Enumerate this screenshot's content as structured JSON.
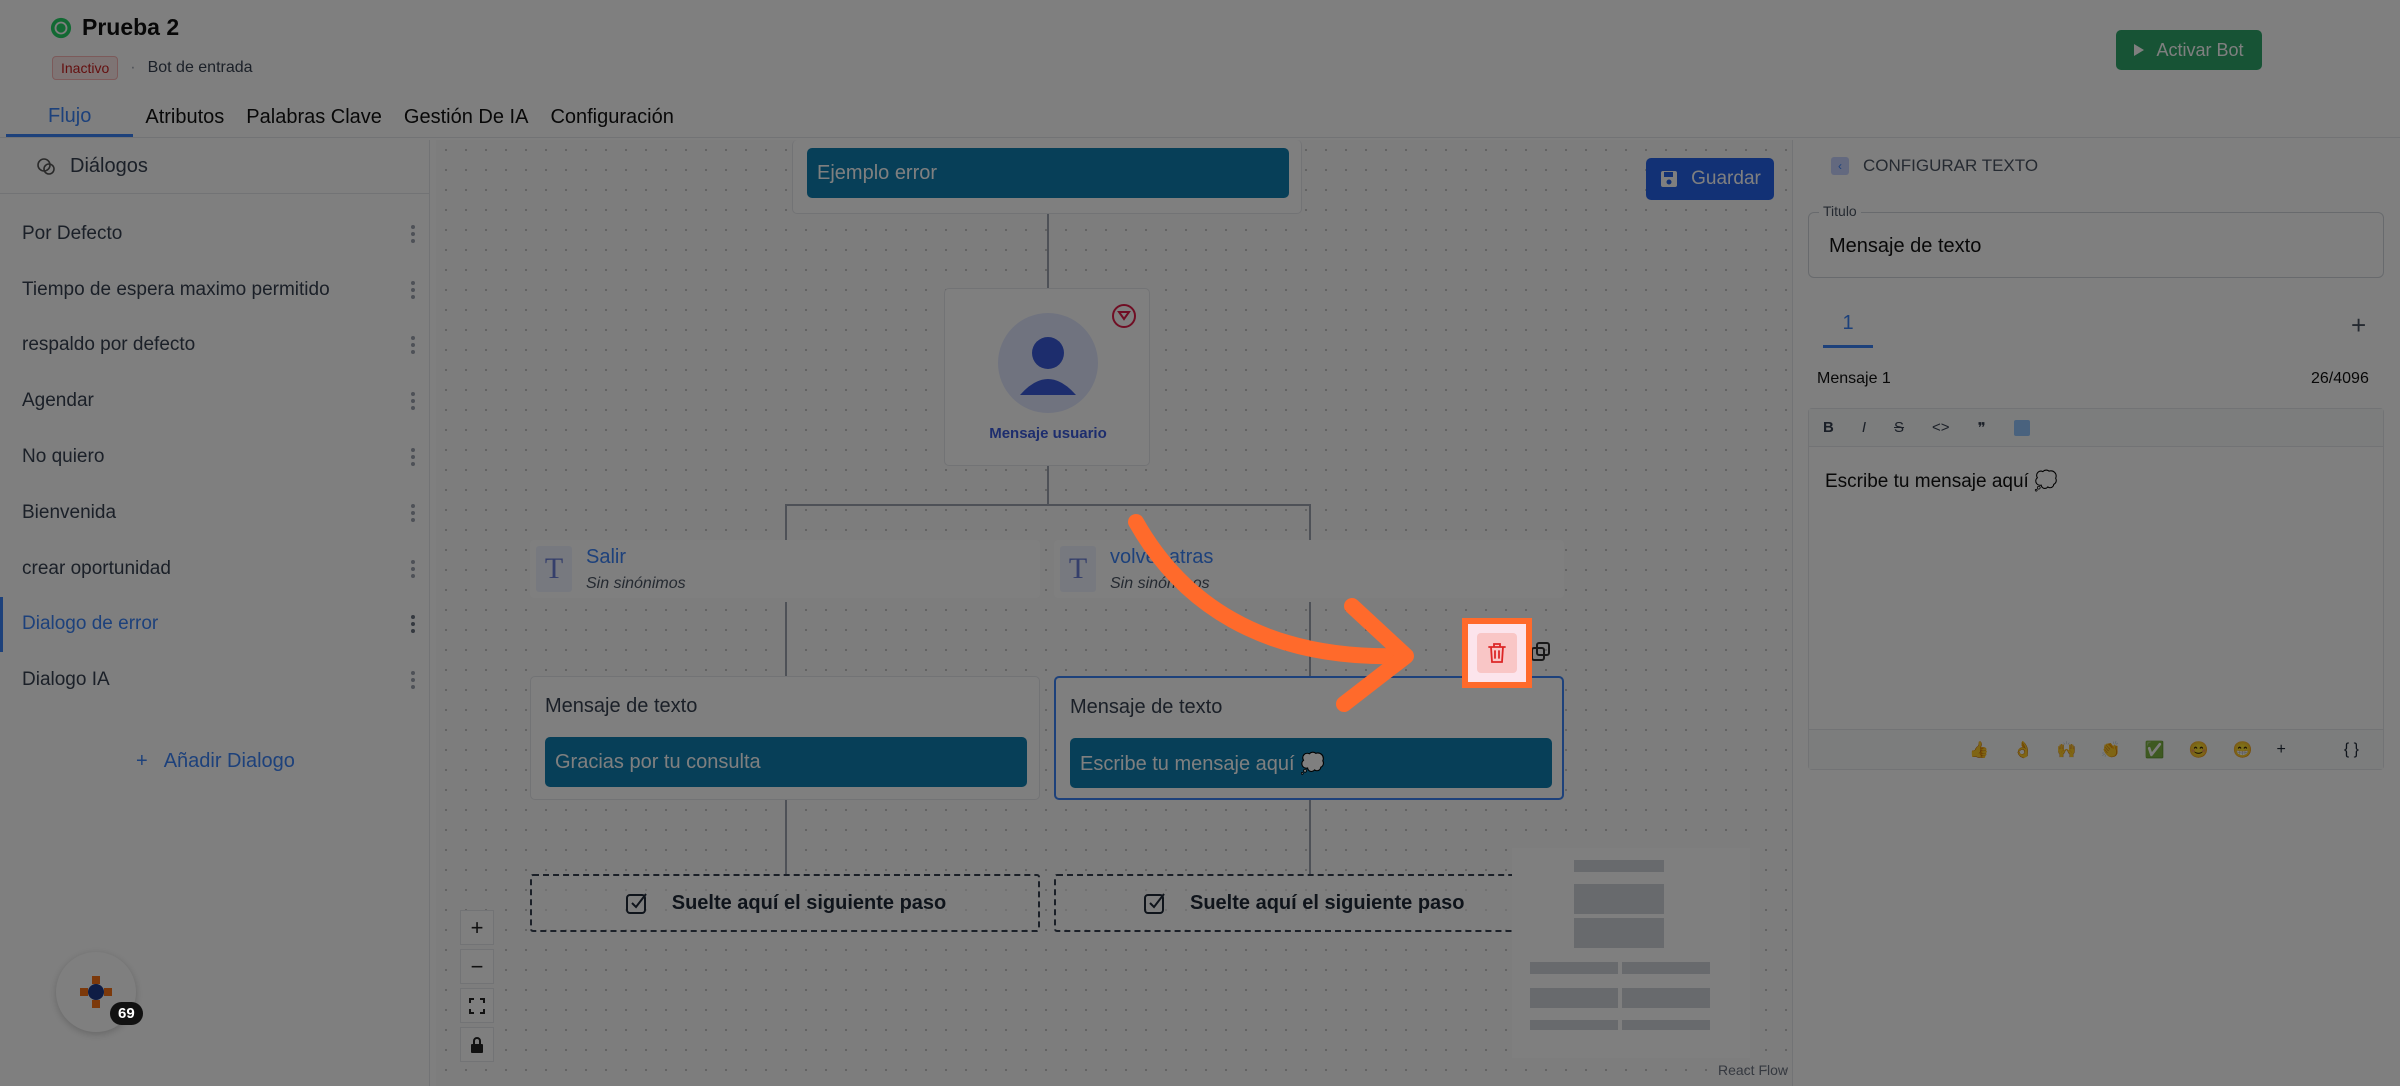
{
  "header": {
    "title": "Prueba 2",
    "status": "Inactivo",
    "separator": "·",
    "subtitle": "Bot de entrada",
    "activate_label": "Activar Bot",
    "accent": "#2ea66a"
  },
  "tabs": [
    "Flujo",
    "Atributos",
    "Palabras Clave",
    "Gestión De IA",
    "Configuración"
  ],
  "sidebar": {
    "heading": "Diálogos",
    "items": [
      {
        "label": "Por Defecto"
      },
      {
        "label": "Tiempo de espera maximo permitido"
      },
      {
        "label": "respaldo por defecto"
      },
      {
        "label": "Agendar"
      },
      {
        "label": "No quiero"
      },
      {
        "label": "Bienvenida"
      },
      {
        "label": "crear oportunidad"
      },
      {
        "label": "Dialogo de error"
      },
      {
        "label": "Dialogo IA"
      }
    ],
    "add_label": "Añadir Dialogo"
  },
  "canvas": {
    "save_label": "Guardar",
    "top_node": "Ejemplo error",
    "user_node_label": "Mensaje usuario",
    "keyword_left_title": "Salir",
    "keyword_left_sub": "Sin sinónimos",
    "keyword_right_title": "volver atras",
    "keyword_right_sub": "Sin sinónimos",
    "text_node_title": "Mensaje de texto",
    "text_left_message": "Gracias por tu consulta",
    "text_right_message": "Escribe tu mensaje aquí 💭",
    "drop_label": "Suelte aquí el siguiente paso",
    "attribution": "React Flow"
  },
  "panel": {
    "heading": "CONFIGURAR TEXTO",
    "title_label": "Titulo",
    "title_value": "Mensaje de texto",
    "message_tab": "1",
    "message_label": "Mensaje 1",
    "message_count": "26/4096",
    "editor_text": "Escribe tu mensaje aquí 💭",
    "toolbar": [
      "B",
      "I",
      "S",
      "<>",
      "❞"
    ],
    "emojis": [
      "👍",
      "👌",
      "🙌",
      "👏",
      "✅",
      "😊",
      "😁"
    ],
    "braces": "{ }"
  },
  "chat": {
    "count": "69"
  }
}
